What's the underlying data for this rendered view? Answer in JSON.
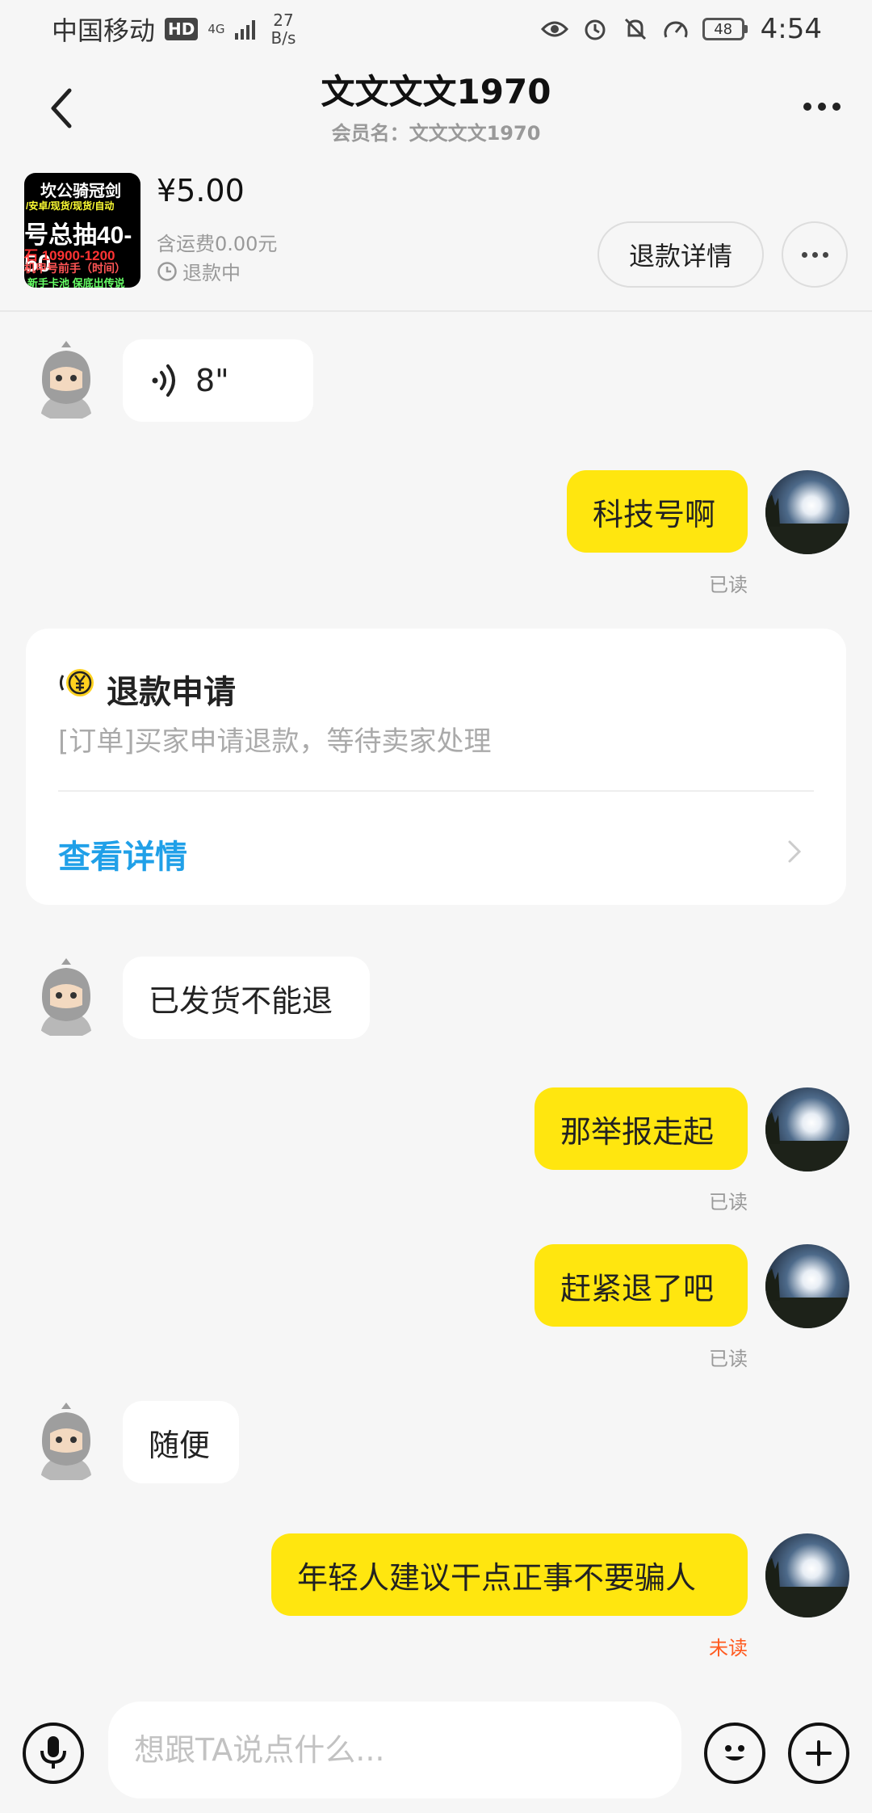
{
  "status_bar": {
    "carrier": "中国移动",
    "hd_badge": "HD",
    "network_type": "4G",
    "speed_value": "27",
    "speed_unit": "B/s",
    "battery": "48",
    "time": "4:54"
  },
  "header": {
    "title": "文文文文1970",
    "subtitle": "会员名：文文文文1970"
  },
  "product": {
    "thumb_lines": [
      "坎公骑冠剑",
      "/安卓/现货/现货/自动",
      "号总抽40-50",
      "石 10900-1200",
      "机甲号前手（时间）",
      "新手卡池 保底出传说"
    ],
    "price": "¥5.00",
    "shipping": "含运费0.00元",
    "status": "退款中",
    "refund_detail_button": "退款详情"
  },
  "messages": [
    {
      "side": "in",
      "type": "voice",
      "duration": "8\""
    },
    {
      "side": "out",
      "text": "科技号啊",
      "read_status": "已读"
    },
    {
      "side": "in",
      "text": "已发货不能退"
    },
    {
      "side": "out",
      "text": "那举报走起",
      "read_status": "已读"
    },
    {
      "side": "out",
      "text": "赶紧退了吧",
      "read_status": "已读"
    },
    {
      "side": "in",
      "text": "随便"
    },
    {
      "side": "out",
      "text": "年轻人建议干点正事不要骗人",
      "read_status": "未读"
    }
  ],
  "refund_card": {
    "title": "退款申请",
    "description": "[订单]买家申请退款，等待卖家处理",
    "link": "查看详情"
  },
  "input": {
    "placeholder": "想跟TA说点什么..."
  },
  "colors": {
    "accent_yellow": "#ffe60f",
    "link_blue": "#20a0e8",
    "unread_orange": "#ff5a1f",
    "background": "#f6f6f6"
  },
  "icons": [
    "back-arrow-icon",
    "more-icon",
    "clock-icon",
    "voice-wave-icon",
    "refund-yen-icon",
    "chevron-right-icon",
    "mic-icon",
    "emoji-icon",
    "plus-icon"
  ]
}
